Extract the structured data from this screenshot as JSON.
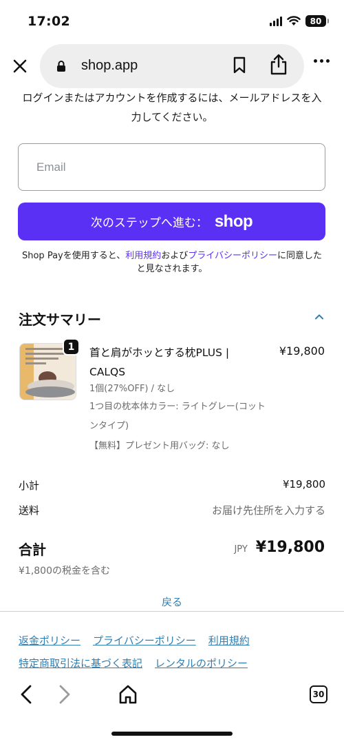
{
  "status_bar": {
    "time": "17:02",
    "battery": "80"
  },
  "browser": {
    "url": "shop.app",
    "tab_count": "30"
  },
  "intro_text": "ログインまたはアカウントを作成するには、メールアドレスを入力してください。",
  "email": {
    "placeholder": "Email",
    "value": ""
  },
  "shop_button": {
    "label": "次のステップへ進む：",
    "logo": "shop"
  },
  "terms": {
    "prefix": "Shop Payを使用すると、",
    "terms_link": "利用規約",
    "middle": "および",
    "privacy_link": "プライバシーポリシー",
    "suffix": "に同意したと見なされます。"
  },
  "order_summary": {
    "title": "注文サマリー",
    "product": {
      "quantity_badge": "1",
      "name": "首と肩がホッとする枕PLUS | CALQS",
      "price": "¥19,800",
      "meta_line1": "1個(27%OFF) / なし",
      "meta_line2": "1つ目の枕本体カラー: ライトグレー(コットンタイプ)",
      "meta_line3": "【無料】プレゼント用バッグ: なし"
    },
    "subtotal": {
      "label": "小計",
      "value": "¥19,800"
    },
    "shipping": {
      "label": "送料",
      "value": "お届け先住所を入力する"
    },
    "total": {
      "label": "合計",
      "currency": "JPY",
      "value": "¥19,800"
    },
    "tax_note": "¥1,800の税金を含む"
  },
  "back_link": "戻る",
  "footer_links": {
    "refund": "返金ポリシー",
    "privacy": "プライバシーポリシー",
    "terms": "利用規約",
    "commerce_law": "特定商取引法に基づく表記",
    "rental": "レンタルのポリシー"
  },
  "colors": {
    "shop_purple": "#5a31f4",
    "link_blue": "#2f7fb5"
  },
  "icons": [
    "close-icon",
    "lock-icon",
    "bookmark-icon",
    "share-icon",
    "more-icon",
    "chevron-up-icon",
    "back-arrow-icon",
    "forward-arrow-icon",
    "home-icon",
    "tabs-icon"
  ]
}
